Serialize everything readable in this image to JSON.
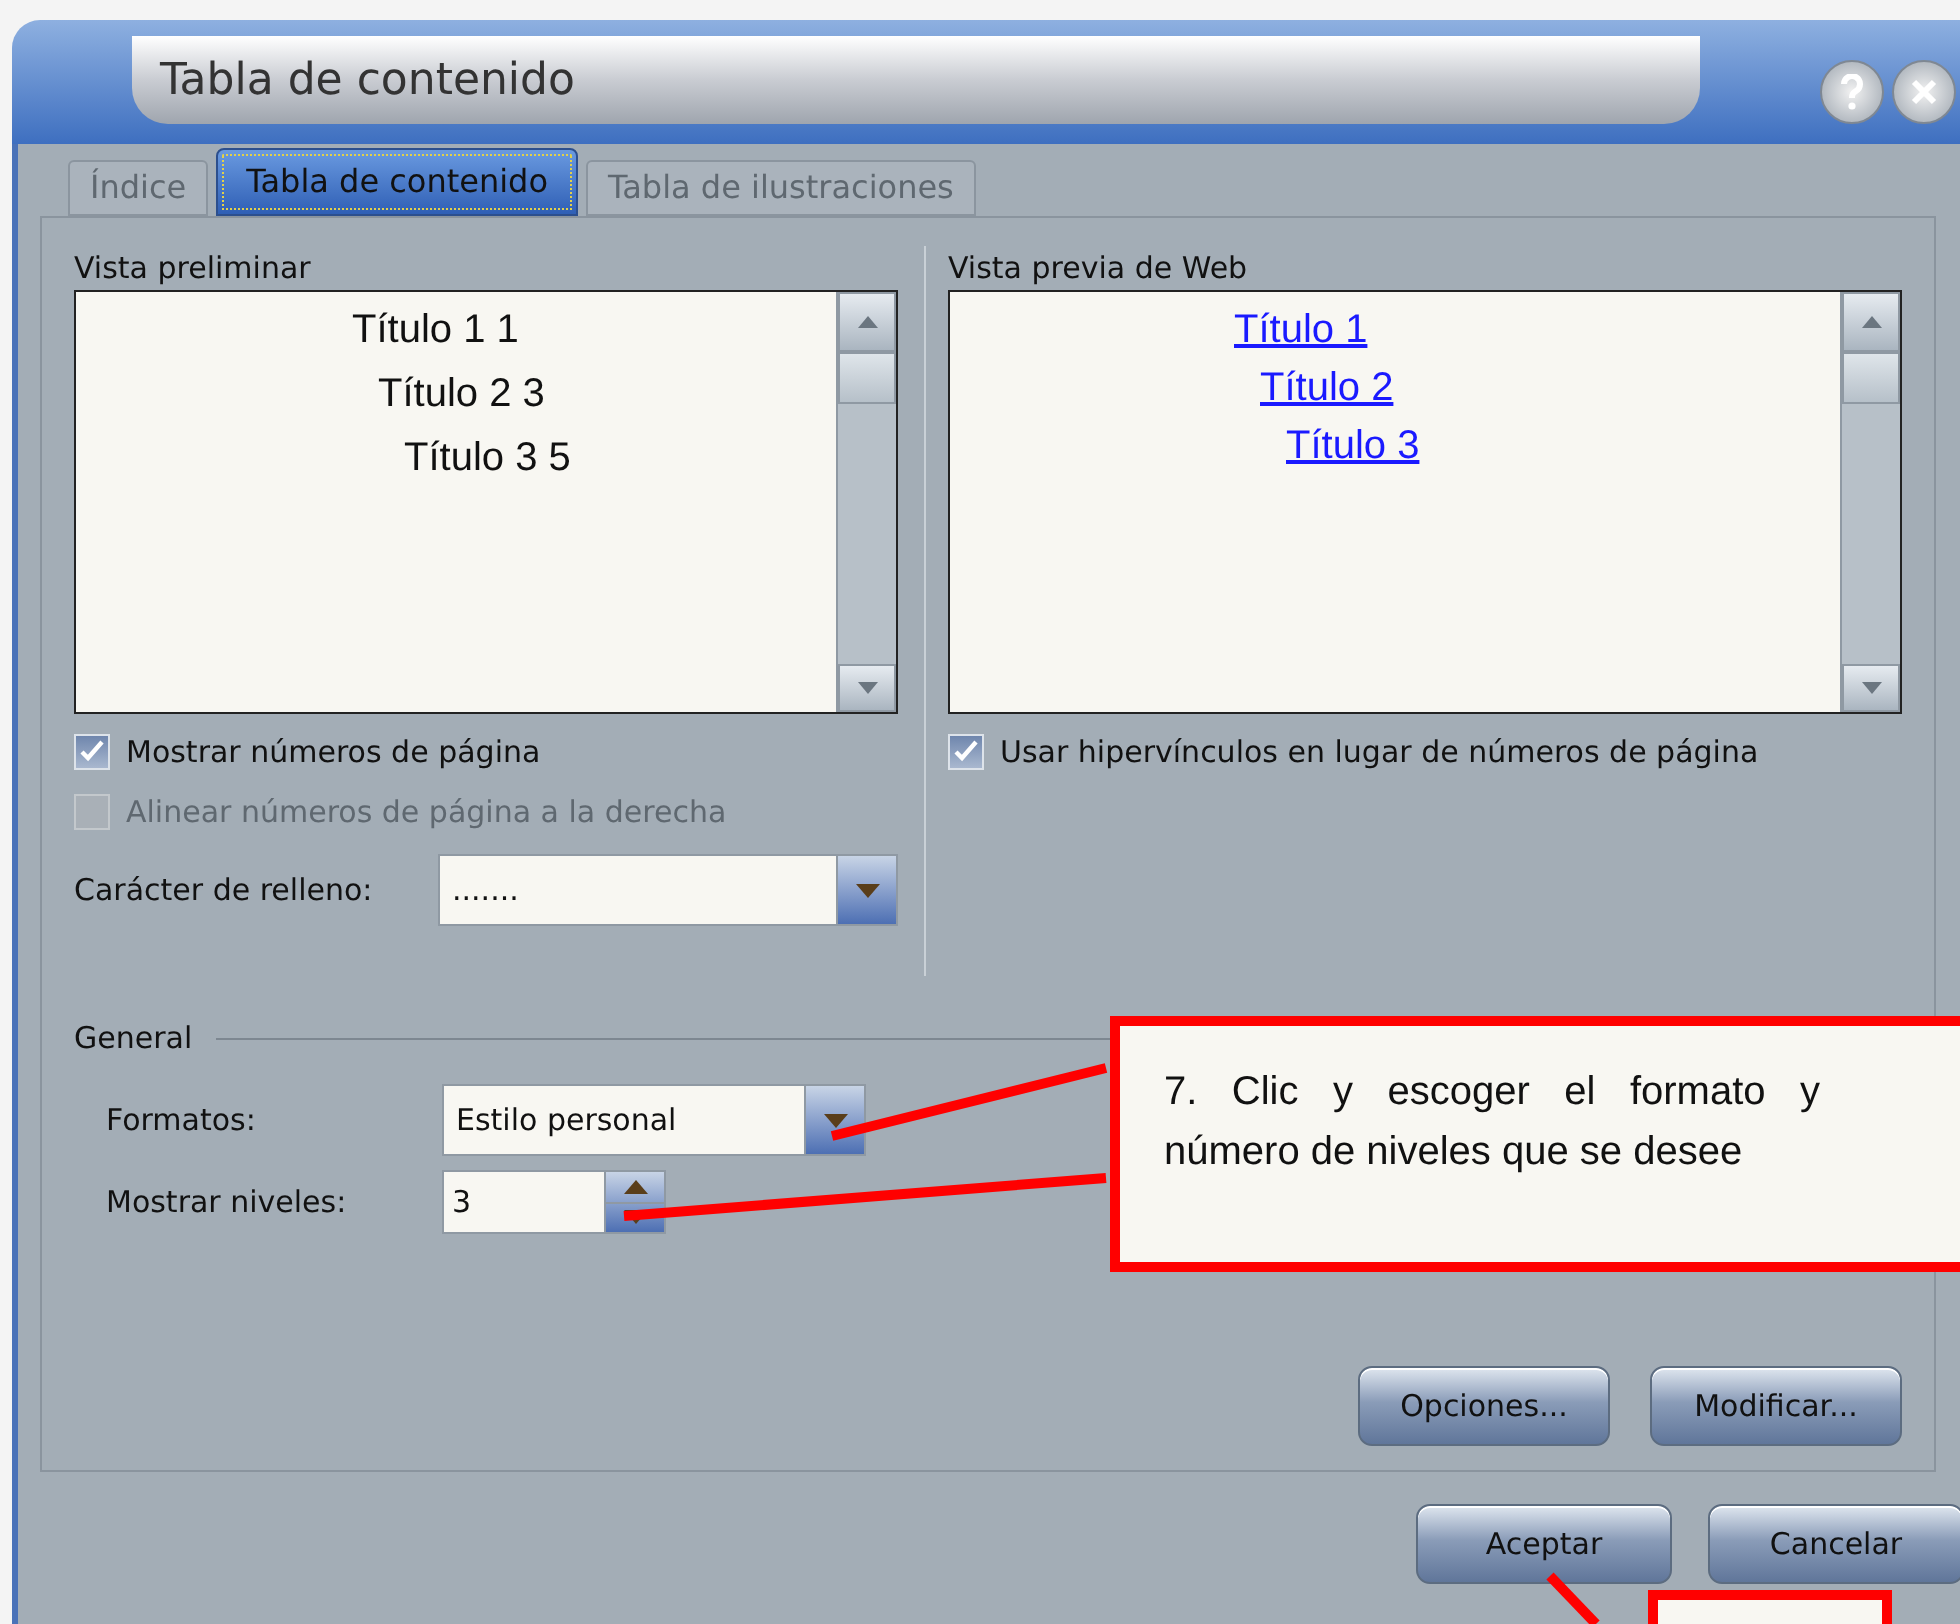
{
  "window": {
    "title": "Tabla de contenido"
  },
  "tabs": [
    {
      "label": "Índice",
      "selected": false
    },
    {
      "label": "Tabla de contenido",
      "selected": true
    },
    {
      "label": "Tabla de ilustraciones",
      "selected": false
    }
  ],
  "print_preview": {
    "label": "Vista preliminar",
    "lines": [
      "Título 1 1",
      "Título 2 3",
      "Título 3 5"
    ]
  },
  "web_preview": {
    "label": "Vista previa de Web",
    "links": [
      "Título 1",
      "Título 2",
      "Título 3"
    ]
  },
  "print_options": [
    {
      "label": "Mostrar números de página",
      "checked": true,
      "disabled": false
    },
    {
      "label": "Alinear números de página a la derecha",
      "checked": false,
      "disabled": true
    }
  ],
  "fill_character": {
    "label": "Carácter de relleno:",
    "value": "......."
  },
  "web_options": [
    {
      "label": "Usar hipervínculos en lugar de números de página",
      "checked": true,
      "disabled": false
    }
  ],
  "general": {
    "label": "General",
    "formats": {
      "label": "Formatos:",
      "value": "Estilo personal"
    },
    "levels": {
      "label": "Mostrar niveles:",
      "value": "3"
    }
  },
  "panel_buttons": [
    "Opciones...",
    "Modificar..."
  ],
  "dialog_buttons": [
    "Aceptar",
    "Cancelar"
  ],
  "annotation": {
    "text": "7. Clic y escoger el formato y número de niveles que se desee"
  }
}
